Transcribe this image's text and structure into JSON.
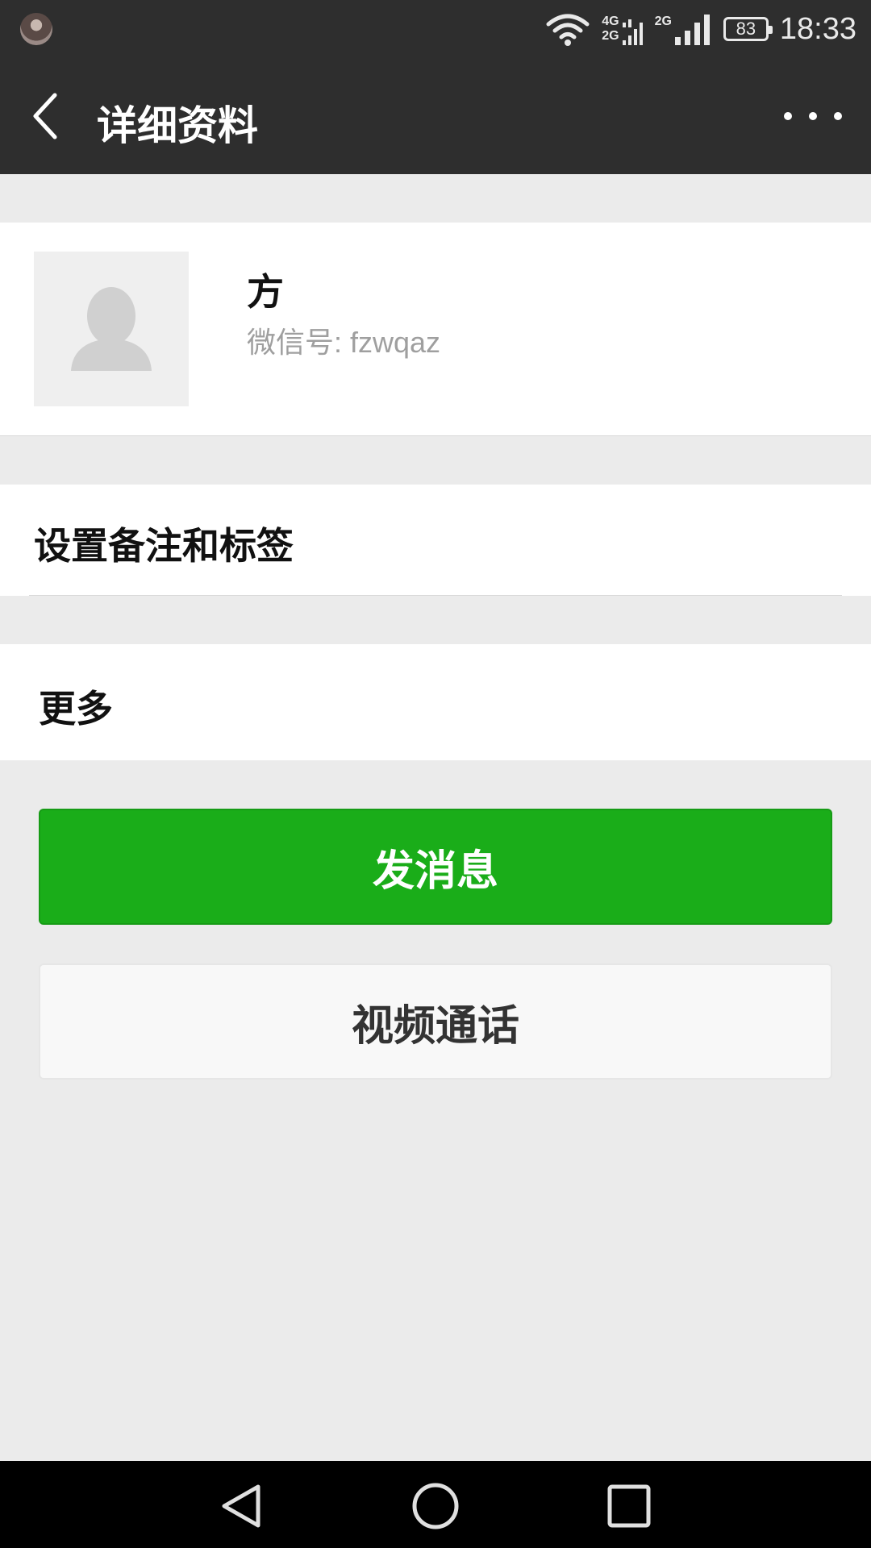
{
  "status_bar": {
    "network_labels": [
      "4G",
      "2G",
      "2G"
    ],
    "battery": "83",
    "time": "18:33"
  },
  "header": {
    "title": "详细资料"
  },
  "profile": {
    "name": "方",
    "wechat_id": "微信号: fzwqaz"
  },
  "rows": {
    "remark_and_tags": "设置备注和标签",
    "more": "更多"
  },
  "buttons": {
    "send_message": "发消息",
    "video_call": "视频通话"
  },
  "colors": {
    "bar": "#2e2e2e",
    "primary_green": "#1aad19",
    "background": "#ebebeb"
  },
  "icons": {
    "back": "chevron-left-icon",
    "more": "more-dots-icon",
    "avatar_placeholder": "person-silhouette-icon",
    "nav_back": "triangle-back-icon",
    "nav_home": "circle-home-icon",
    "nav_recent": "square-recent-icon"
  }
}
